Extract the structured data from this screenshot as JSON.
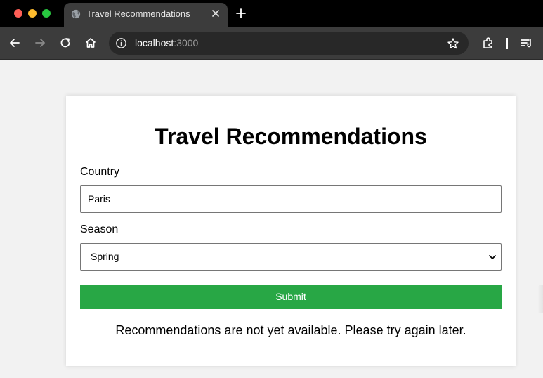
{
  "browser": {
    "tab": {
      "title": "Travel Recommendations",
      "favicon": "globe-icon"
    },
    "address": {
      "host": "localhost",
      "port": ":3000"
    },
    "icons": [
      "back-arrow-icon",
      "forward-arrow-icon",
      "reload-icon",
      "home-icon",
      "info-icon",
      "star-icon",
      "extensions-icon",
      "tab-search-icon"
    ],
    "colors": {
      "tab_bar": "#000000",
      "toolbar": "#3c3c3c",
      "omnibox": "#282828"
    }
  },
  "page": {
    "title": "Travel Recommendations",
    "country": {
      "label": "Country",
      "value": "Paris"
    },
    "season": {
      "label": "Season",
      "selected": "Spring"
    },
    "submit_label": "Submit",
    "message": "Recommendations are not yet available. Please try again later.",
    "colors": {
      "submit": "#28a745",
      "background": "#f2f2f2",
      "card": "#ffffff"
    }
  }
}
